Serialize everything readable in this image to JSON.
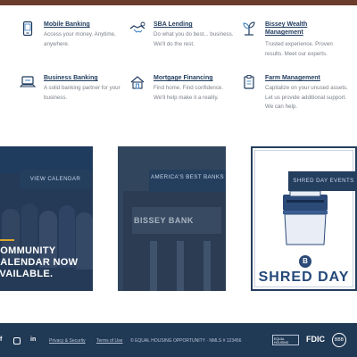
{
  "services": [
    {
      "title": "Mobile Banking",
      "desc": "Access your money. Anytime, anywhere.",
      "icon": "mobile-phone-icon"
    },
    {
      "title": "SBA Lending",
      "desc": "Do what you do best... business. We'll do the rest.",
      "icon": "handshake-icon"
    },
    {
      "title": "Bissey Wealth Management",
      "desc": "Trusted experience. Proven results. Meet our experts.",
      "icon": "wealth-plant-icon"
    },
    {
      "title": "Business Banking",
      "desc": "A solid banking partner for your business.",
      "icon": "laptop-icon"
    },
    {
      "title": "Mortgage Financing",
      "desc": "Find home. Find confidence. We'll help make it a reality.",
      "icon": "house-icon"
    },
    {
      "title": "Farm Management",
      "desc": "Capitalize on your unused assets. Let us provide additional support. We can help.",
      "icon": "clipboard-icon"
    }
  ],
  "cards": {
    "calendar": {
      "label": "VIEW CALENDAR",
      "headline": [
        "COMMUNITY",
        "CALENDAR NOW",
        "AVAILABLE."
      ]
    },
    "best_banks": {
      "label": "AMERICA'S BEST BANKS",
      "sign": "BISSEY BANK"
    },
    "shred": {
      "label": "SHRED DAY EVENTS",
      "title": "SHRED DAY"
    }
  },
  "footer": {
    "social": [
      "f",
      "ig",
      "in"
    ],
    "links": [
      "Privacy & Security",
      "Terms of Use"
    ],
    "notice": "© EQUAL HOUSING OPPORTUNITY  ·  NMLS # 123456",
    "badges": [
      "EQUAL HOUSING LENDER",
      "FDIC",
      "BBB"
    ]
  },
  "colors": {
    "navy": "#1f3b5e",
    "label_bg": "#243e5e",
    "footer_bg": "#203955",
    "accent_gold": "#d9a62a",
    "text_gray": "#7a7f87"
  }
}
